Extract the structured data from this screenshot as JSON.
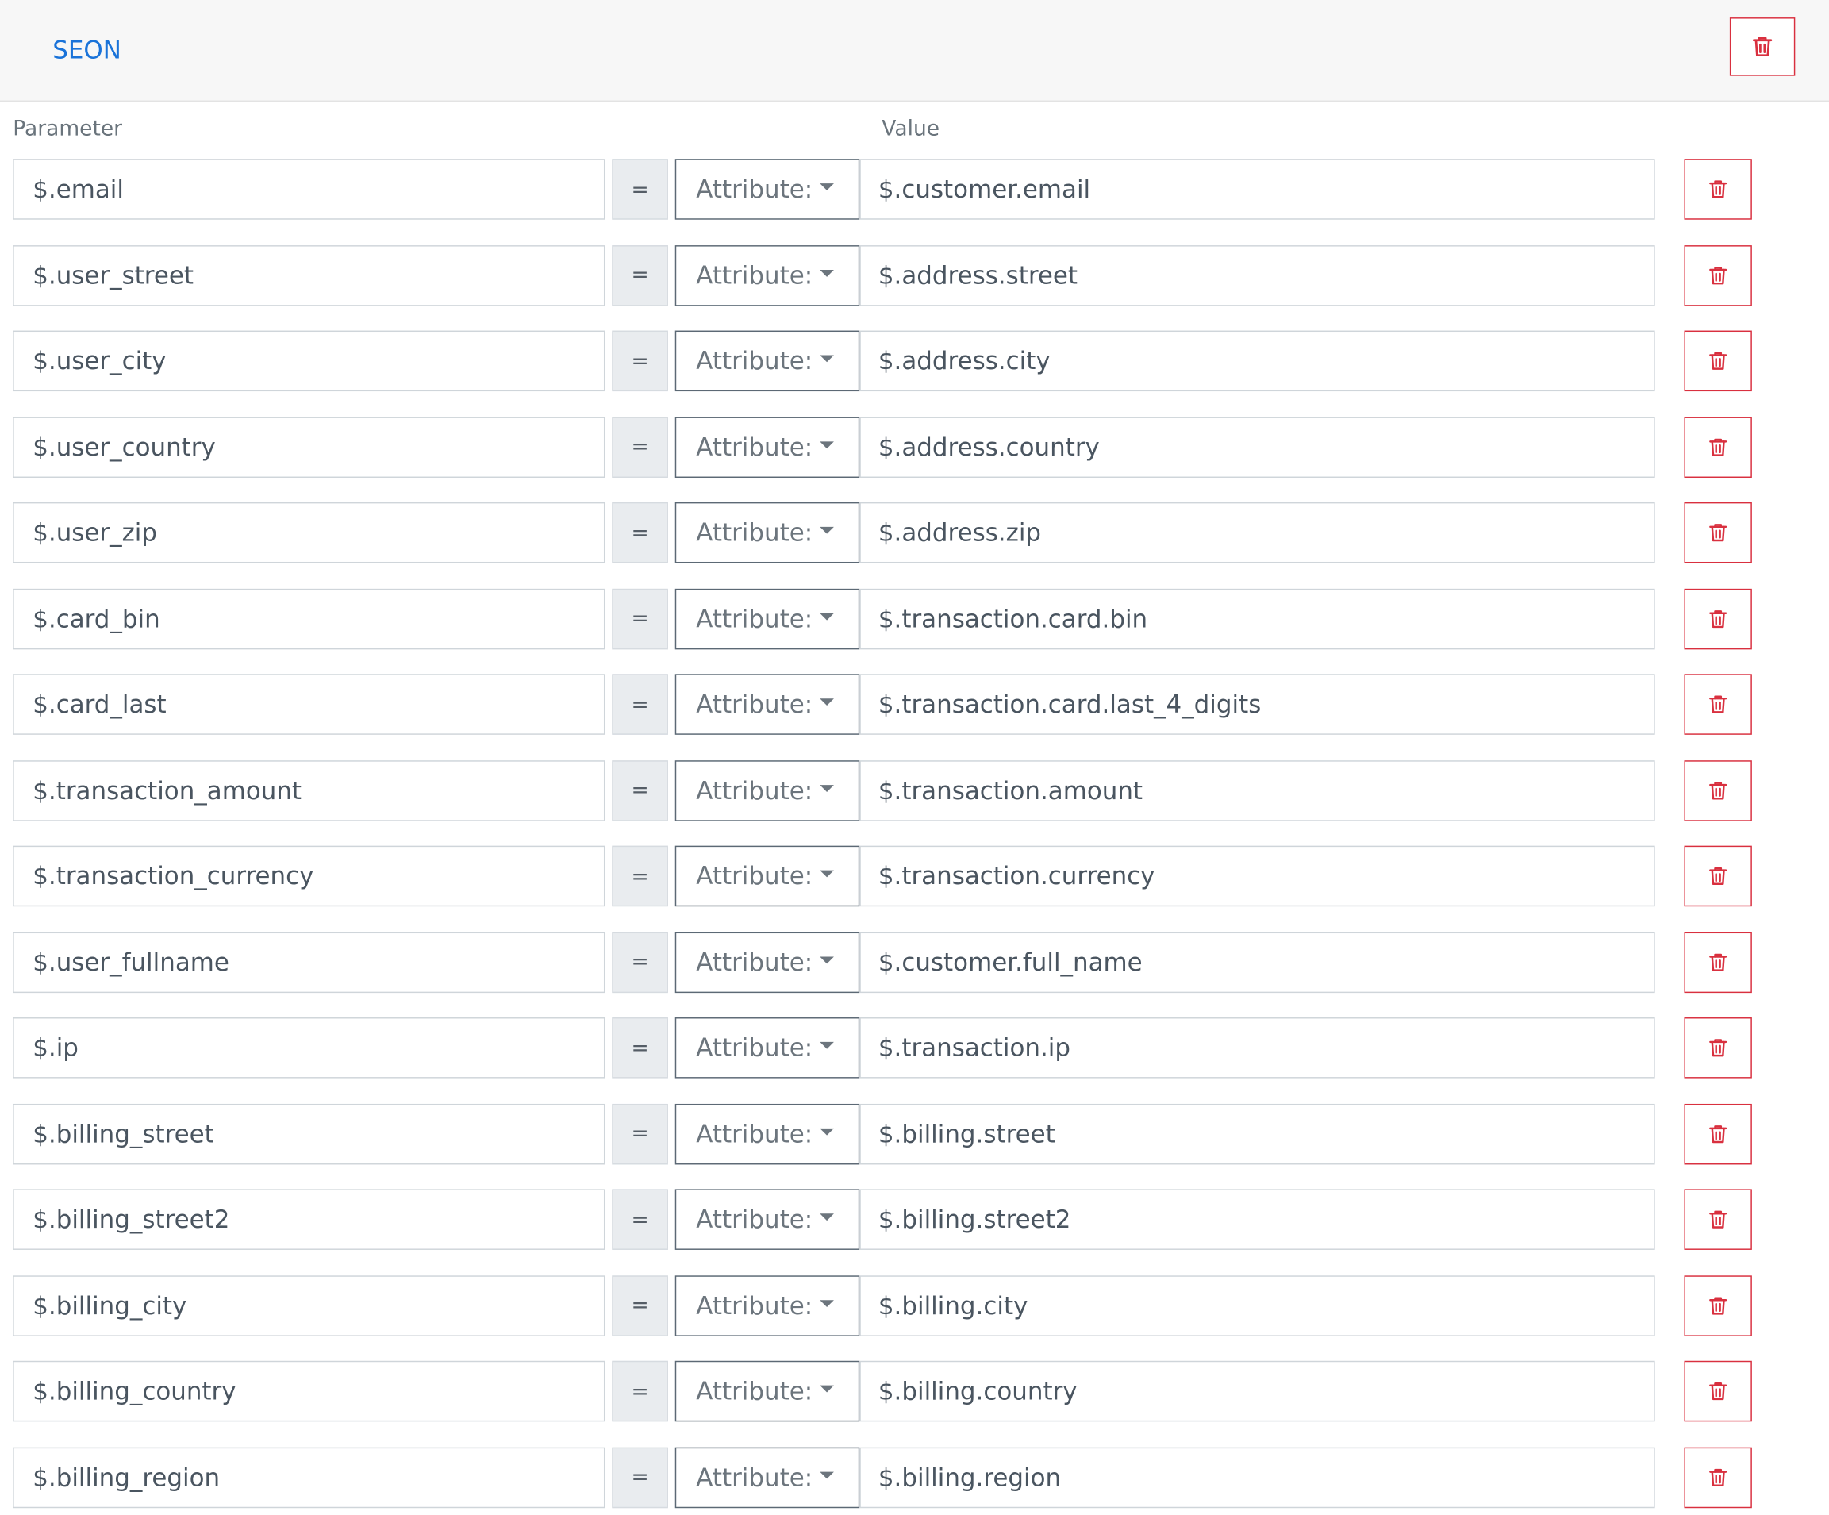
{
  "header": {
    "title": "SEON"
  },
  "columns": {
    "parameter_label": "Parameter",
    "value_label": "Value"
  },
  "rows": [
    {
      "parameter": "$.email",
      "operator": "=",
      "type": "Attribute:",
      "value": "$.customer.email"
    },
    {
      "parameter": "$.user_street",
      "operator": "=",
      "type": "Attribute:",
      "value": "$.address.street"
    },
    {
      "parameter": "$.user_city",
      "operator": "=",
      "type": "Attribute:",
      "value": "$.address.city"
    },
    {
      "parameter": "$.user_country",
      "operator": "=",
      "type": "Attribute:",
      "value": "$.address.country"
    },
    {
      "parameter": "$.user_zip",
      "operator": "=",
      "type": "Attribute:",
      "value": "$.address.zip"
    },
    {
      "parameter": "$.card_bin",
      "operator": "=",
      "type": "Attribute:",
      "value": "$.transaction.card.bin"
    },
    {
      "parameter": "$.card_last",
      "operator": "=",
      "type": "Attribute:",
      "value": "$.transaction.card.last_4_digits"
    },
    {
      "parameter": "$.transaction_amount",
      "operator": "=",
      "type": "Attribute:",
      "value": "$.transaction.amount"
    },
    {
      "parameter": "$.transaction_currency",
      "operator": "=",
      "type": "Attribute:",
      "value": "$.transaction.currency"
    },
    {
      "parameter": "$.user_fullname",
      "operator": "=",
      "type": "Attribute:",
      "value": "$.customer.full_name"
    },
    {
      "parameter": "$.ip",
      "operator": "=",
      "type": "Attribute:",
      "value": "$.transaction.ip"
    },
    {
      "parameter": "$.billing_street",
      "operator": "=",
      "type": "Attribute:",
      "value": "$.billing.street"
    },
    {
      "parameter": "$.billing_street2",
      "operator": "=",
      "type": "Attribute:",
      "value": "$.billing.street2"
    },
    {
      "parameter": "$.billing_city",
      "operator": "=",
      "type": "Attribute:",
      "value": "$.billing.city"
    },
    {
      "parameter": "$.billing_country",
      "operator": "=",
      "type": "Attribute:",
      "value": "$.billing.country"
    },
    {
      "parameter": "$.billing_region",
      "operator": "=",
      "type": "Attribute:",
      "value": "$.billing.region"
    }
  ],
  "icons": {
    "delete": "trash-icon",
    "dropdown": "caret-down-icon"
  },
  "colors": {
    "accent": "#1a73d9",
    "danger": "#d9303f"
  }
}
